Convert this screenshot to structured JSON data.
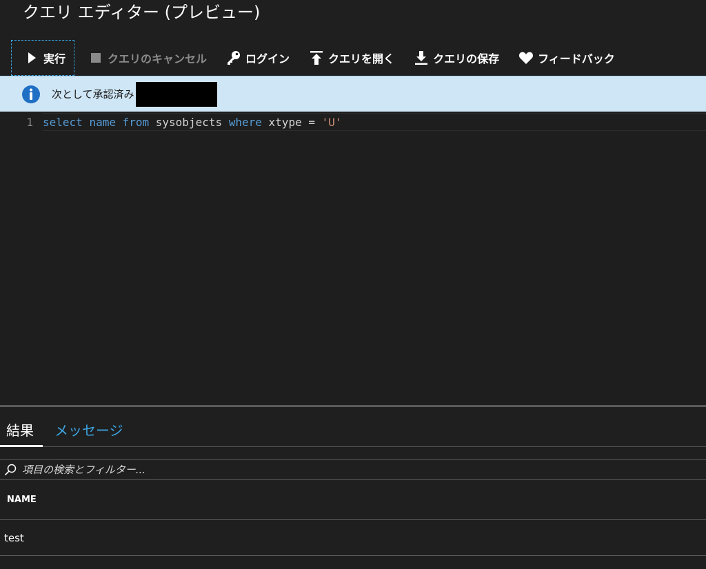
{
  "window": {
    "title": "クエリ エディター (プレビュー)"
  },
  "toolbar": {
    "run_label": "実行",
    "cancel_label": "クエリのキャンセル",
    "login_label": "ログイン",
    "open_label": "クエリを開く",
    "save_label": "クエリの保存",
    "feedback_label": "フィードバック"
  },
  "banner": {
    "text": "次として承認済み"
  },
  "editor": {
    "line_number": "1",
    "tokens": {
      "t1": "select",
      "t2": " ",
      "t3": "name",
      "t4": " ",
      "t5": "from",
      "t6": " sysobjects ",
      "t7": "where",
      "t8": " xtype = ",
      "t9": "'U'"
    }
  },
  "results": {
    "tabs": {
      "results_label": "結果",
      "messages_label": "メッセージ"
    },
    "filter": {
      "placeholder": "項目の検索とフィルター..."
    },
    "columns": [
      "NAME"
    ],
    "rows": [
      [
        "test"
      ]
    ]
  },
  "colors": {
    "accent": "#3ba4e0",
    "banner_bg": "#cfe6f6",
    "keyword": "#569cd6",
    "string": "#ce9178"
  }
}
